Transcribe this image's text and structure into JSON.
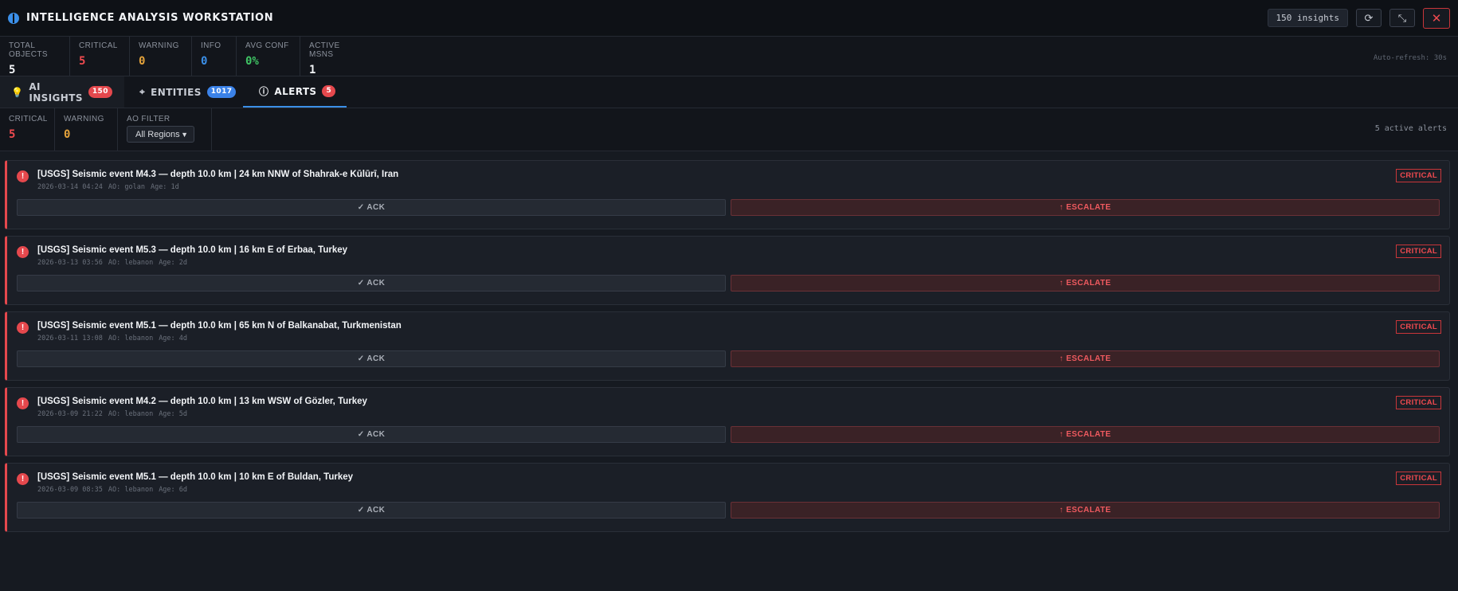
{
  "header": {
    "title": "INTELLIGENCE ANALYSIS WORKSTATION",
    "insights_pill": "150 insights",
    "icons": [
      "brain-icon",
      "refresh-icon",
      "minimize-icon",
      "close-icon"
    ],
    "refresh_glyph": "⟳",
    "minimize_glyph": "⤡",
    "close_glyph": "✕"
  },
  "stats": [
    {
      "label": "TOTAL OBJECTS",
      "value": "5",
      "color": "#f2f4f7"
    },
    {
      "label": "CRITICAL",
      "value": "5",
      "color": "#ef4a4f"
    },
    {
      "label": "WARNING",
      "value": "0",
      "color": "#e5a33b"
    },
    {
      "label": "INFO",
      "value": "0",
      "color": "#3b8fe8"
    },
    {
      "label": "AVG CONF",
      "value": "0%",
      "color": "#3fc464"
    },
    {
      "label": "ACTIVE MSNS",
      "value": "1",
      "color": "#f2f4f7"
    }
  ],
  "auto_refresh": "Auto-refresh: 30s",
  "tabs": [
    {
      "label": "AI INSIGHTS",
      "badge": "150",
      "icon": "lightbulb-icon",
      "glyph": "💡"
    },
    {
      "label": "ENTITIES",
      "badge": "1017",
      "icon": "crosshair-icon",
      "glyph": "⌖"
    },
    {
      "label": "ALERTS",
      "badge": "5",
      "icon": "alert-icon",
      "glyph": "ⓘ"
    }
  ],
  "filter": {
    "critical_label": "CRITICAL",
    "critical_value": "5",
    "warning_label": "WARNING",
    "warning_value": "0",
    "ao_label": "AO FILTER",
    "ao_value": "All Regions",
    "active_count": "5 active alerts"
  },
  "alerts": [
    {
      "title": "[USGS] Seismic event M4.3 — depth 10.0 km | 24 km NNW of Shahrak-e Kūlūrī, Iran",
      "time": "2026-03-14 04:24",
      "ao": "AO: golan",
      "age": "Age: 1d",
      "severity": "CRITICAL",
      "ack": "✓ ACK",
      "escalate": "↑ ESCALATE"
    },
    {
      "title": "[USGS] Seismic event M5.3 — depth 10.0 km | 16 km E of Erbaa, Turkey",
      "time": "2026-03-13 03:56",
      "ao": "AO: lebanon",
      "age": "Age: 2d",
      "severity": "CRITICAL",
      "ack": "✓ ACK",
      "escalate": "↑ ESCALATE"
    },
    {
      "title": "[USGS] Seismic event M5.1 — depth 10.0 km | 65 km N of Balkanabat, Turkmenistan",
      "time": "2026-03-11 13:08",
      "ao": "AO: lebanon",
      "age": "Age: 4d",
      "severity": "CRITICAL",
      "ack": "✓ ACK",
      "escalate": "↑ ESCALATE"
    },
    {
      "title": "[USGS] Seismic event M4.2 — depth 10.0 km | 13 km WSW of Gözler, Turkey",
      "time": "2026-03-09 21:22",
      "ao": "AO: lebanon",
      "age": "Age: 5d",
      "severity": "CRITICAL",
      "ack": "✓ ACK",
      "escalate": "↑ ESCALATE"
    },
    {
      "title": "[USGS] Seismic event M5.1 — depth 10.0 km | 10 km E of Buldan, Turkey",
      "time": "2026-03-09 08:35",
      "ao": "AO: lebanon",
      "age": "Age: 6d",
      "severity": "CRITICAL",
      "ack": "✓ ACK",
      "escalate": "↑ ESCALATE"
    }
  ]
}
